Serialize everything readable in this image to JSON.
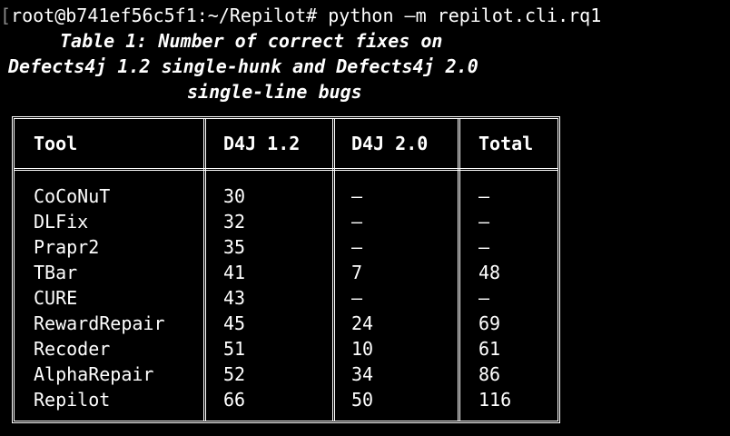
{
  "terminal": {
    "prompt_bracket": "[",
    "command_line": "root@b741ef56c5f1:~/Repilot# python –m repilot.cli.rq1"
  },
  "caption": {
    "line1": "Table 1: Number of correct fixes on",
    "line2": "Defects4j 1.2 single-hunk and Defects4j 2.0",
    "line3": "single-line bugs"
  },
  "table": {
    "headers": [
      "Tool",
      "D4J 1.2",
      "D4J 2.0",
      "Total"
    ],
    "rows": [
      [
        "CoCoNuT",
        "30",
        "–",
        "–"
      ],
      [
        "DLFix",
        "32",
        "–",
        "–"
      ],
      [
        "Prapr2",
        "35",
        "–",
        "–"
      ],
      [
        "TBar",
        "41",
        "7",
        "48"
      ],
      [
        "CURE",
        "43",
        "–",
        "–"
      ],
      [
        "RewardRepair",
        "45",
        "24",
        "69"
      ],
      [
        "Recoder",
        "51",
        "10",
        "61"
      ],
      [
        "AlphaRepair",
        "52",
        "34",
        "86"
      ],
      [
        "Repilot",
        "66",
        "50",
        "116"
      ]
    ]
  },
  "colors": {
    "background": "#000000",
    "text": "#ffffff",
    "bracket": "#8a8a8a"
  }
}
